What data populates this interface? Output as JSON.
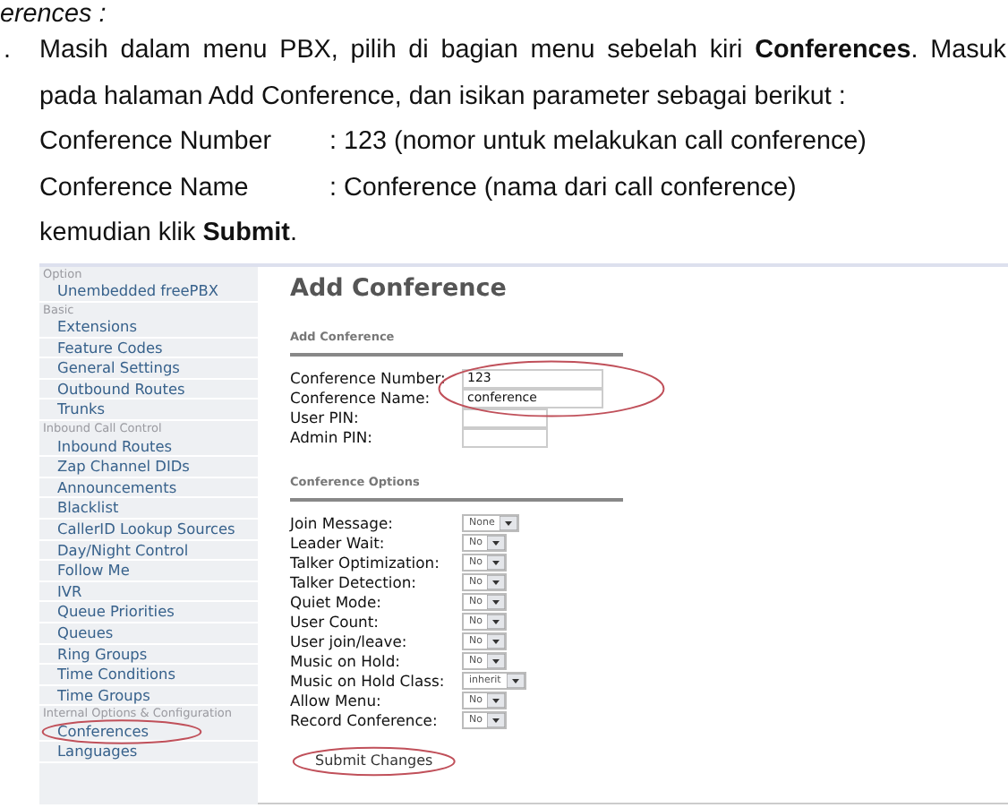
{
  "document": {
    "heading_fragment": "erences :",
    "list_marker": ".",
    "paragraph": "Masih dalam menu PBX, pilih di bagian menu sebelah kiri **Conferences**. Masuk pada halaman Add Conference, dan isikan parameter sebagai berikut :",
    "params": [
      {
        "label": "Conference Number",
        "value": ": 123 (nomor untuk melakukan call conference)"
      },
      {
        "label": "Conference Name",
        "value": ": Conference (nama dari call conference)"
      }
    ],
    "closing": "kemudian klik **Submit**."
  },
  "screenshot": {
    "sidebar": [
      {
        "kind": "header",
        "label": "Option"
      },
      {
        "kind": "item",
        "label": "Unembedded freePBX",
        "circled": false
      },
      {
        "kind": "header",
        "label": "Basic"
      },
      {
        "kind": "item",
        "label": "Extensions",
        "circled": false
      },
      {
        "kind": "item",
        "label": "Feature Codes",
        "circled": false
      },
      {
        "kind": "item",
        "label": "General Settings",
        "circled": false
      },
      {
        "kind": "item",
        "label": "Outbound Routes",
        "circled": false
      },
      {
        "kind": "item",
        "label": "Trunks",
        "circled": false
      },
      {
        "kind": "header",
        "label": "Inbound Call Control"
      },
      {
        "kind": "item",
        "label": "Inbound Routes",
        "circled": false
      },
      {
        "kind": "item",
        "label": "Zap Channel DIDs",
        "circled": false
      },
      {
        "kind": "item",
        "label": "Announcements",
        "circled": false
      },
      {
        "kind": "item",
        "label": "Blacklist",
        "circled": false
      },
      {
        "kind": "item",
        "label": "CallerID Lookup Sources",
        "circled": false
      },
      {
        "kind": "item",
        "label": "Day/Night Control",
        "circled": false
      },
      {
        "kind": "item",
        "label": "Follow Me",
        "circled": false
      },
      {
        "kind": "item",
        "label": "IVR",
        "circled": false
      },
      {
        "kind": "item",
        "label": "Queue Priorities",
        "circled": false
      },
      {
        "kind": "item",
        "label": "Queues",
        "circled": false
      },
      {
        "kind": "item",
        "label": "Ring Groups",
        "circled": false
      },
      {
        "kind": "item",
        "label": "Time Conditions",
        "circled": false
      },
      {
        "kind": "item",
        "label": "Time Groups",
        "circled": false
      },
      {
        "kind": "header",
        "label": "Internal Options & Configuration"
      },
      {
        "kind": "item",
        "label": "Conferences",
        "circled": true
      },
      {
        "kind": "item",
        "label": "Languages",
        "circled": false
      }
    ],
    "page_title": "Add Conference",
    "sections": [
      {
        "title": "Add Conference",
        "fields": [
          {
            "kind": "input",
            "label": "Conference Number:",
            "value": "123",
            "circled": true
          },
          {
            "kind": "input",
            "label": "Conference Name:",
            "value": "conference",
            "circled": true
          },
          {
            "kind": "input",
            "label": "User PIN:",
            "circled": false
          },
          {
            "kind": "input",
            "label": "Admin PIN:",
            "circled": false
          }
        ]
      },
      {
        "title": "Conference Options",
        "fields": [
          {
            "kind": "select",
            "label": "Join Message:",
            "value": "None"
          },
          {
            "kind": "select",
            "label": "Leader Wait:",
            "value": "No"
          },
          {
            "kind": "select",
            "label": "Talker Optimization:",
            "value": "No"
          },
          {
            "kind": "select",
            "label": "Talker Detection:",
            "value": "No"
          },
          {
            "kind": "select",
            "label": "Quiet Mode:",
            "value": "No"
          },
          {
            "kind": "select",
            "label": "User Count:",
            "value": "No"
          },
          {
            "kind": "select",
            "label": "User join/leave:",
            "value": "No"
          },
          {
            "kind": "select",
            "label": "Music on Hold:",
            "value": "No"
          },
          {
            "kind": "select",
            "label": "Music on Hold Class:",
            "value": "inherit"
          },
          {
            "kind": "select",
            "label": "Allow Menu:",
            "value": "No"
          },
          {
            "kind": "select",
            "label": "Record Conference:",
            "value": "No"
          }
        ]
      }
    ],
    "submit": {
      "label": "Submit Changes",
      "circled": true
    }
  }
}
